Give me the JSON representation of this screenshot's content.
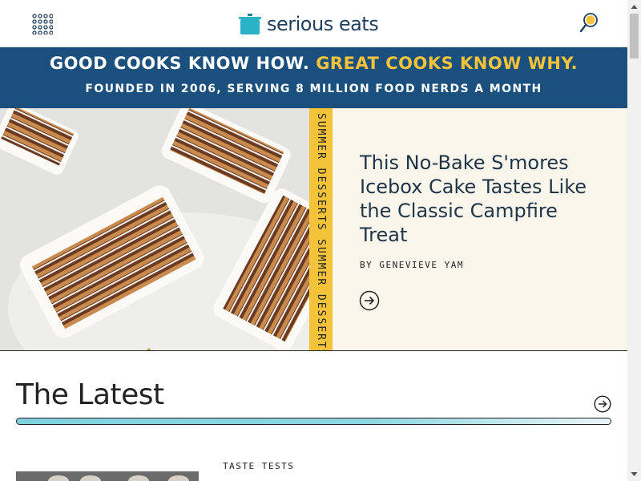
{
  "header": {
    "logo_text": "serious eats",
    "menu_icon": "grid-menu-icon",
    "search_icon": "search-icon",
    "brand_color": "#1f3f5f",
    "logo_pot_color": "#29b3c4"
  },
  "banner": {
    "line1_white": "GOOD COOKS KNOW HOW.",
    "line1_accent": "GREAT COOKS KNOW WHY.",
    "line2": "FOUNDED IN 2006, SERVING 8 MILLION FOOD NERDS A MONTH",
    "background_color": "#1b4f7e",
    "accent_color": "#f5c33a"
  },
  "hero": {
    "tag": "SUMMER DESSERTS   SUMMER DESSERTS",
    "title": "This No-Bake S'mores Icebox Cake Tastes Like the Classic Campfire Treat",
    "byline_prefix": "BY",
    "author": "GENEVIEVE YAM",
    "arrow_icon": "arrow-right-circle-icon",
    "panel_color": "#faf6ec",
    "tag_color": "#f5c33a"
  },
  "latest": {
    "title": "The Latest",
    "arrow_icon": "arrow-right-circle-icon",
    "first_card_label": "TASTE TESTS"
  },
  "scrollbar": {
    "up_icon": "scroll-up-arrow-icon",
    "down_icon": "scroll-down-arrow-icon"
  }
}
